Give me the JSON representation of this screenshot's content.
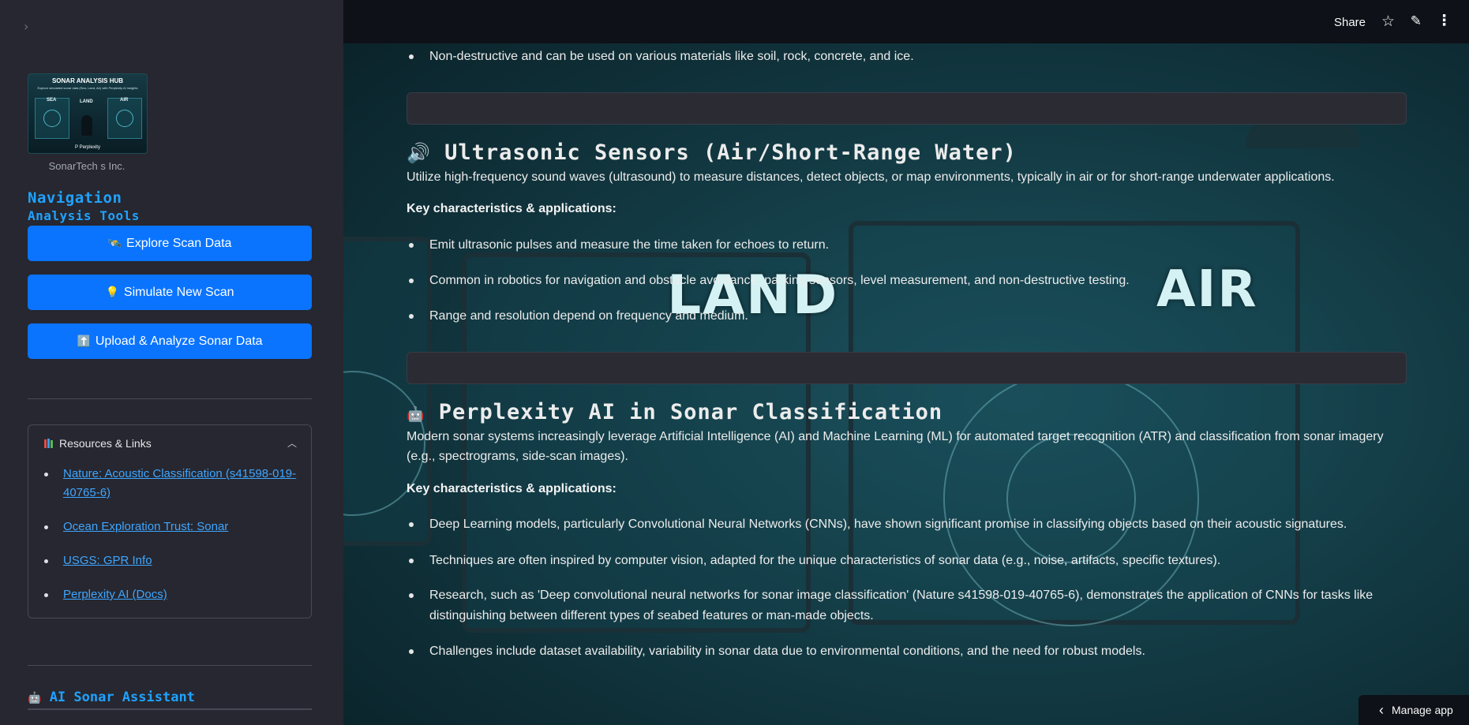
{
  "sidebar": {
    "collapse_icon": "›",
    "logo": {
      "title": "SONAR ANALYSIS HUB",
      "subtitle": "Explore simulated sonar data (Sea, Land, Air) with Perplexity AI insights",
      "labels": [
        "SEA",
        "LAND",
        "AIR"
      ],
      "footer": "P Perplexity"
    },
    "company": "SonarTech s Inc.",
    "nav_title": "Navigation",
    "nav_subtitle": "Analysis Tools",
    "buttons": [
      {
        "icon": "🛰️",
        "label": "Explore Scan Data"
      },
      {
        "icon": "💡",
        "label": "Simulate New Scan"
      },
      {
        "icon": "⬆️",
        "label": "Upload & Analyze Sonar Data"
      }
    ],
    "resources": {
      "label": "Resources & Links",
      "links": [
        "Nature: Acoustic Classification (s41598-019-40765-6)",
        "Ocean Exploration Trust: Sonar",
        "USGS: GPR Info",
        "Perplexity AI (Docs)"
      ]
    },
    "ai_assistant": {
      "icon": "🤖",
      "label": "AI Sonar Assistant"
    }
  },
  "toolbar": {
    "share_label": "Share",
    "star_icon": "☆",
    "edit_icon": "✎",
    "menu_icon": "⋮"
  },
  "background": {
    "land_label": "LAND",
    "air_label": "AIR"
  },
  "main": {
    "top_bullet": "Non-destructive and can be used on various materials like soil, rock, concrete, and ice.",
    "ultrasonic": {
      "icon": "🔊",
      "title": "Ultrasonic Sensors (Air/Short-Range Water)",
      "description": "Utilize high-frequency sound waves (ultrasound) to measure distances, detect objects, or map environments, typically in air or for short-range underwater applications.",
      "key_label": "Key characteristics & applications:",
      "bullets": [
        "Emit ultrasonic pulses and measure the time taken for echoes to return.",
        "Common in robotics for navigation and obstacle avoidance, parking sensors, level measurement, and non-destructive testing.",
        "Range and resolution depend on frequency and medium."
      ]
    },
    "perplexity": {
      "icon": "🤖",
      "title": "Perplexity AI in Sonar Classification",
      "description": "Modern sonar systems increasingly leverage Artificial Intelligence (AI) and Machine Learning (ML) for automated target recognition (ATR) and classification from sonar imagery (e.g., spectrograms, side-scan images).",
      "key_label": "Key characteristics & applications:",
      "bullets": [
        "Deep Learning models, particularly Convolutional Neural Networks (CNNs), have shown significant promise in classifying objects based on their acoustic signatures.",
        "Techniques are often inspired by computer vision, adapted for the unique characteristics of sonar data (e.g., noise, artifacts, specific textures).",
        "Research, such as 'Deep convolutional neural networks for sonar image classification' (Nature s41598-019-40765-6), demonstrates the application of CNNs for tasks like distinguishing between different types of seabed features or man-made objects.",
        "Challenges include dataset availability, variability in sonar data due to environmental conditions, and the need for robust models."
      ]
    }
  },
  "manage_app": {
    "icon": "‹",
    "label": "Manage app"
  }
}
